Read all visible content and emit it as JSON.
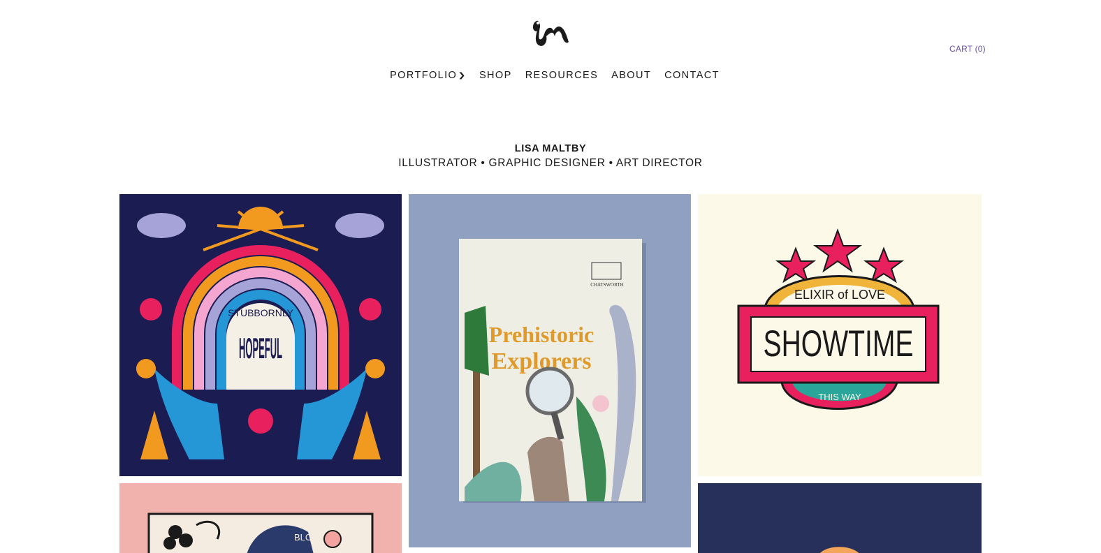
{
  "header": {
    "logo_text": "lm",
    "cart_label": "CART (0)"
  },
  "nav": {
    "items": [
      {
        "label": "PORTFOLIO",
        "has_dropdown": true
      },
      {
        "label": "SHOP"
      },
      {
        "label": "RESOURCES"
      },
      {
        "label": "ABOUT"
      },
      {
        "label": "CONTACT"
      }
    ]
  },
  "intro": {
    "name": "LISA MALTBY",
    "roles": "ILLUSTRATOR • GRAPHIC DESIGNER • ART DIRECTOR"
  },
  "gallery": {
    "tiles": [
      {
        "name": "stubbornly-hopeful",
        "text_top": "STUBBORNLY",
        "text_main": "HOPEFUL"
      },
      {
        "name": "prehistoric-explorers",
        "brand": "CHATSWORTH",
        "title_line1": "Prehistoric",
        "title_line2": "Explorers"
      },
      {
        "name": "elixir-of-love-showtime",
        "arc_top": "ELIXIR of LOVE",
        "main": "SHOWTIME",
        "arc_bottom": "THIS WAY"
      },
      {
        "name": "bloom-print",
        "fragment": "BLOO"
      },
      {
        "name": "navy-print"
      }
    ]
  },
  "colors": {
    "accent": "#6a4fa0",
    "navy": "#1b1c52",
    "pink": "#e8215e",
    "orange": "#f29a1f",
    "cream": "#fdf9e8"
  }
}
